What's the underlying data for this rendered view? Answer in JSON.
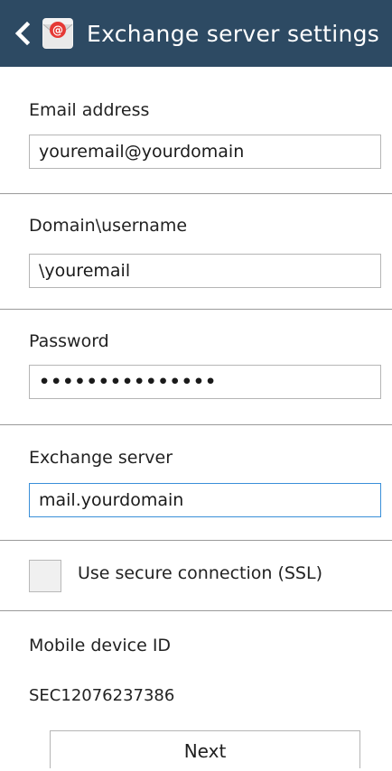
{
  "header": {
    "title": "Exchange server settings",
    "app_icon": "email-app-icon",
    "back_icon": "chevron-left-icon",
    "background_color": "#2d4a63"
  },
  "form": {
    "email": {
      "label": "Email address",
      "value": "youremail@yourdomain"
    },
    "username": {
      "label": "Domain\\username",
      "value": "\\youremail"
    },
    "password": {
      "label": "Password",
      "value": "•••••••••••••••"
    },
    "server": {
      "label": "Exchange server",
      "value": "mail.yourdomain"
    },
    "ssl": {
      "label": "Use secure connection (SSL)",
      "checked": false
    },
    "device_id": {
      "label": "Mobile device ID",
      "value": "SEC12076237386"
    }
  },
  "footer": {
    "next_label": "Next"
  },
  "colors": {
    "focus_border": "#3a8fd9",
    "divider": "#9a9a9a"
  }
}
